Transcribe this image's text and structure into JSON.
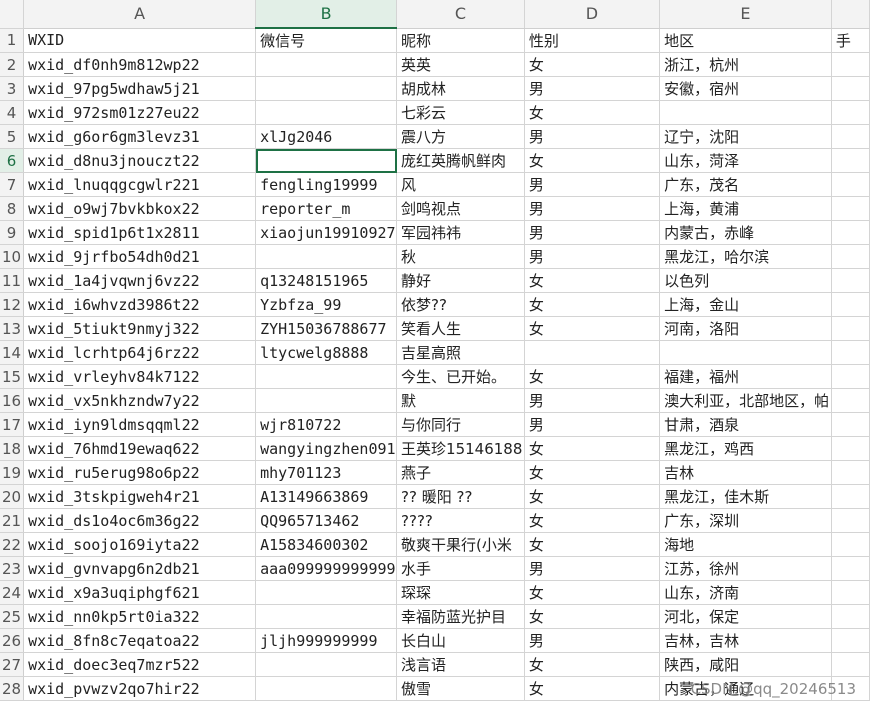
{
  "columns": [
    "A",
    "B",
    "C",
    "D",
    "E"
  ],
  "row_numbers": [
    "1",
    "2",
    "3",
    "4",
    "5",
    "6",
    "7",
    "8",
    "9",
    "10",
    "11",
    "12",
    "13",
    "14",
    "15",
    "16",
    "17",
    "18",
    "19",
    "20",
    "21",
    "22",
    "23",
    "24",
    "25",
    "26",
    "27",
    "28"
  ],
  "header_row": {
    "a": "WXID",
    "b": "微信号",
    "c": "昵称",
    "d": "性别",
    "e": "地区",
    "f": "手"
  },
  "rows": [
    {
      "a": "wxid_df0nh9m812wp22",
      "b": "",
      "c": "英英",
      "d": "女",
      "e": "浙江，杭州"
    },
    {
      "a": "wxid_97pg5wdhaw5j21",
      "b": "",
      "c": "胡成林",
      "d": "男",
      "e": "安徽，宿州"
    },
    {
      "a": "wxid_972sm01z27eu22",
      "b": "",
      "c": "七彩云",
      "d": "女",
      "e": ""
    },
    {
      "a": "wxid_g6or6gm3levz31",
      "b": "xlJg2046",
      "c": "震八方",
      "d": "男",
      "e": "辽宁，沈阳"
    },
    {
      "a": "wxid_d8nu3jnouczt22",
      "b": "",
      "c": "庞红英腾帆鲜肉",
      "d": "女",
      "e": "山东，菏泽"
    },
    {
      "a": "wxid_lnuqqgcgwlr221",
      "b": "fengling19999",
      "c": "风",
      "d": "男",
      "e": "广东，茂名"
    },
    {
      "a": "wxid_o9wj7bvkbkox22",
      "b": "reporter_m",
      "c": "剑鸣视点",
      "d": "男",
      "e": "上海，黄浦"
    },
    {
      "a": "wxid_spid1p6t1x2811",
      "b": "xiaojun19910927",
      "c": "军园祎祎",
      "d": "男",
      "e": "内蒙古，赤峰"
    },
    {
      "a": "wxid_9jrfbo54dh0d21",
      "b": "",
      "c": "秋",
      "d": "男",
      "e": "黑龙江，哈尔滨"
    },
    {
      "a": "wxid_1a4jvqwnj6vz22",
      "b": "q13248151965",
      "c": "静好",
      "d": "女",
      "e": "以色列"
    },
    {
      "a": "wxid_i6whvzd3986t22",
      "b": "Yzbfza_99",
      "c": "依梦??",
      "d": "女",
      "e": "上海，金山"
    },
    {
      "a": "wxid_5tiukt9nmyj322",
      "b": "ZYH15036788677",
      "c": "笑看人生",
      "d": "女",
      "e": "河南，洛阳"
    },
    {
      "a": "wxid_lcrhtp64j6rz22",
      "b": "ltycwelg8888",
      "c": "吉星高照",
      "d": "",
      "e": ""
    },
    {
      "a": "wxid_vrleyhv84k7122",
      "b": "",
      "c": "今生、已开始。",
      "d": "女",
      "e": "福建，福州"
    },
    {
      "a": "wxid_vx5nkhzndw7y22",
      "b": "",
      "c": "默",
      "d": "男",
      "e": "澳大利亚，北部地区，帕"
    },
    {
      "a": "wxid_iyn9ldmsqqml22",
      "b": "wjr810722",
      "c": "与你同行",
      "d": "男",
      "e": "甘肃，酒泉"
    },
    {
      "a": "wxid_76hmd19ewaq622",
      "b": "wangyingzhen091",
      "c": "王英珍15146188",
      "d": "女",
      "e": "黑龙江，鸡西"
    },
    {
      "a": "wxid_ru5erug98o6p22",
      "b": "mhy701123",
      "c": "燕子",
      "d": "女",
      "e": "吉林"
    },
    {
      "a": "wxid_3tskpigweh4r21",
      "b": "A13149663869",
      "c": "?? 暖阳 ??",
      "d": "女",
      "e": "黑龙江，佳木斯"
    },
    {
      "a": "wxid_ds1o4oc6m36g22",
      "b": "QQ965713462",
      "c": "????",
      "d": "女",
      "e": "广东，深圳"
    },
    {
      "a": "wxid_soojo169iyta22",
      "b": "A15834600302",
      "c": "敬爽干果行(小米",
      "d": "女",
      "e": "海地"
    },
    {
      "a": "wxid_gvnvapg6n2db21",
      "b": "aaa099999999999",
      "c": "水手",
      "d": "男",
      "e": "江苏，徐州"
    },
    {
      "a": "wxid_x9a3uqiphgf621",
      "b": "",
      "c": "琛琛",
      "d": "女",
      "e": "山东，济南"
    },
    {
      "a": "wxid_nn0kp5rt0ia322",
      "b": "",
      "c": "幸福防蓝光护目",
      "d": "女",
      "e": "河北，保定"
    },
    {
      "a": "wxid_8fn8c7eqatoa22",
      "b": "jljh999999999",
      "c": "长白山",
      "d": "男",
      "e": "吉林，吉林"
    },
    {
      "a": "wxid_doec3eq7mzr522",
      "b": "",
      "c": "浅言语",
      "d": "女",
      "e": "陕西，咸阳"
    },
    {
      "a": "wxid_pvwzv2qo7hir22",
      "b": "",
      "c": "傲雪",
      "d": "女",
      "e": "内蒙古，通辽"
    }
  ],
  "watermark": "CSDN @qq_20246513",
  "accent_color": "#1e7145"
}
